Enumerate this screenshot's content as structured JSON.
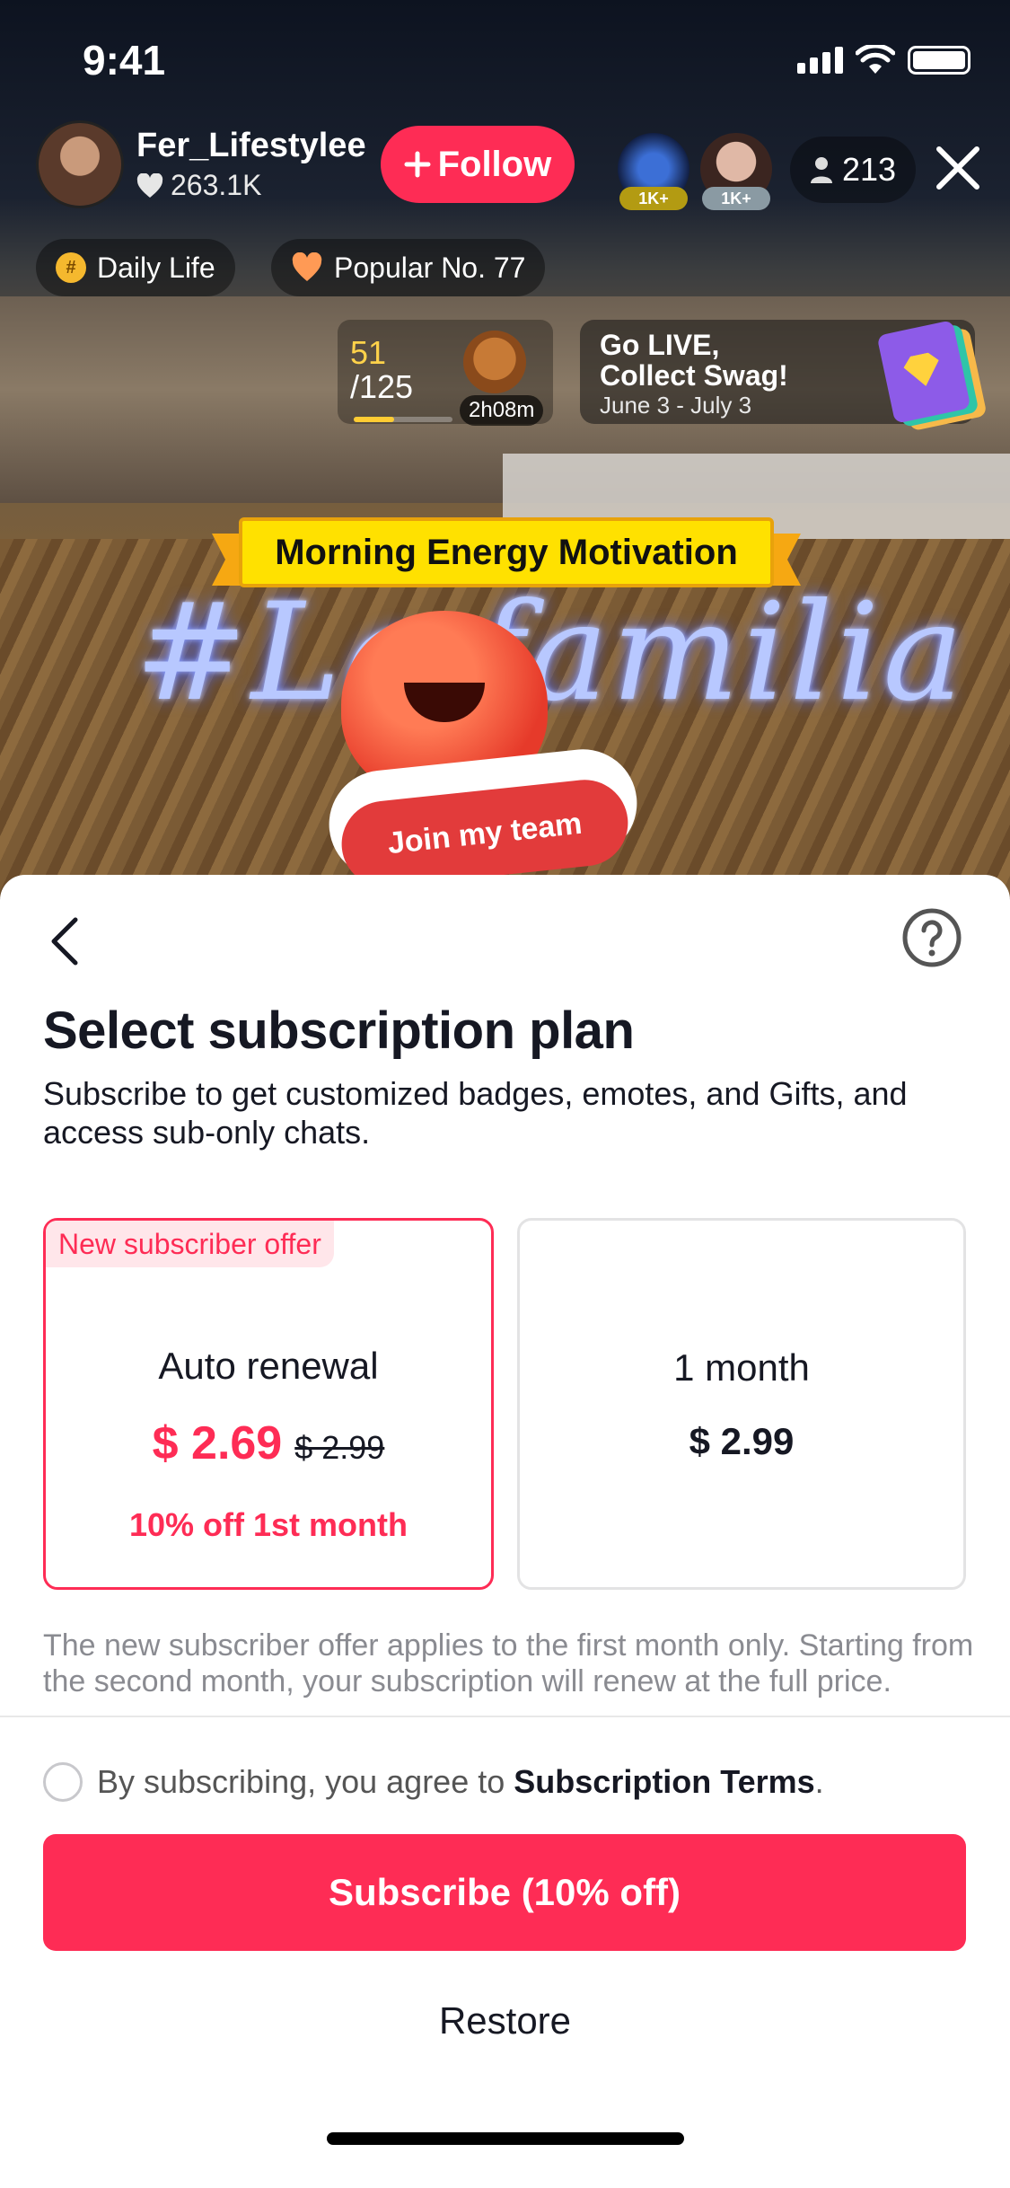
{
  "status_bar": {
    "time": "9:41"
  },
  "host": {
    "name": "Fer_Lifestylee",
    "likes": "263.1K",
    "follow_label": "Follow"
  },
  "viewers": [
    {
      "badge": "1K+"
    },
    {
      "badge": "1K+"
    }
  ],
  "viewer_count": "213",
  "chips": [
    {
      "label": "Daily Life"
    },
    {
      "label": "Popular No. 77"
    }
  ],
  "rank": {
    "current": "51",
    "total": "/125",
    "timer": "2h08m",
    "progress": 0.41
  },
  "promo": {
    "line1": "Go LIVE,",
    "line2": "Collect Swag!",
    "dates": "June 3 - July 3"
  },
  "banner": {
    "title": "Morning Energy Motivation"
  },
  "video": {
    "neon_text": "#La familia",
    "join_label": "Join my team"
  },
  "sheet": {
    "title": "Select subscription plan",
    "subtitle": "Subscribe to get customized badges, emotes, and Gifts, and access sub-only chats.",
    "plans": [
      {
        "tag": "New subscriber offer",
        "name": "Auto renewal",
        "price": "$ 2.69",
        "old_price": "$ 2.99",
        "discount": "10% off 1st month"
      },
      {
        "name": "1 month",
        "price": "$ 2.99"
      }
    ],
    "note": "The new subscriber offer applies to the first month only. Starting from the second month, your subscription will renew at the full price.",
    "agree_prefix": "By subscribing, you agree to",
    "agree_link": "Subscription Terms",
    "agree_suffix": ".",
    "subscribe_label": "Subscribe (10% off)",
    "restore_label": "Restore"
  },
  "colors": {
    "accent": "#fe2c55",
    "banner": "#ffe100",
    "text": "#161823",
    "muted": "#8a8b91"
  }
}
